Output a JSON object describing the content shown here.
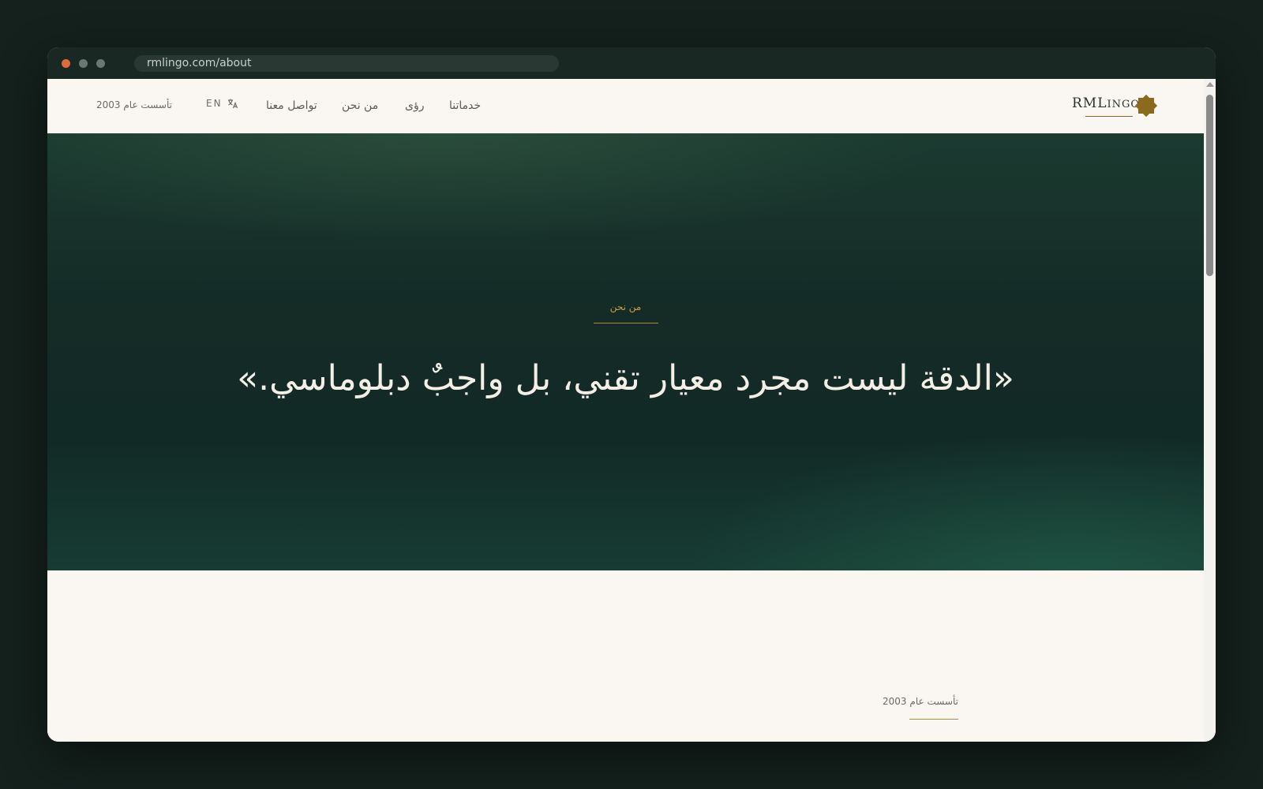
{
  "browser": {
    "url": "rmlingo.com/about"
  },
  "header": {
    "founded": "تأسست عام 2003",
    "lang_label": "EN",
    "nav": {
      "contact": "تواصل معنا",
      "about": "من نحن",
      "visions": "رؤى",
      "services": "خدماتنا"
    },
    "logo": {
      "main": "RML",
      "rest": "INGO"
    }
  },
  "hero": {
    "eyebrow": "من نحن",
    "quote": "«الدقة ليست مجرد معيار تقني، بل واجبٌ دبلوماسي.»"
  },
  "section": {
    "label": "تأسست عام 2003"
  },
  "colors": {
    "accent_gold": "#b08a34",
    "hero_green": "#142b26",
    "page_bg": "#faf7f2"
  }
}
